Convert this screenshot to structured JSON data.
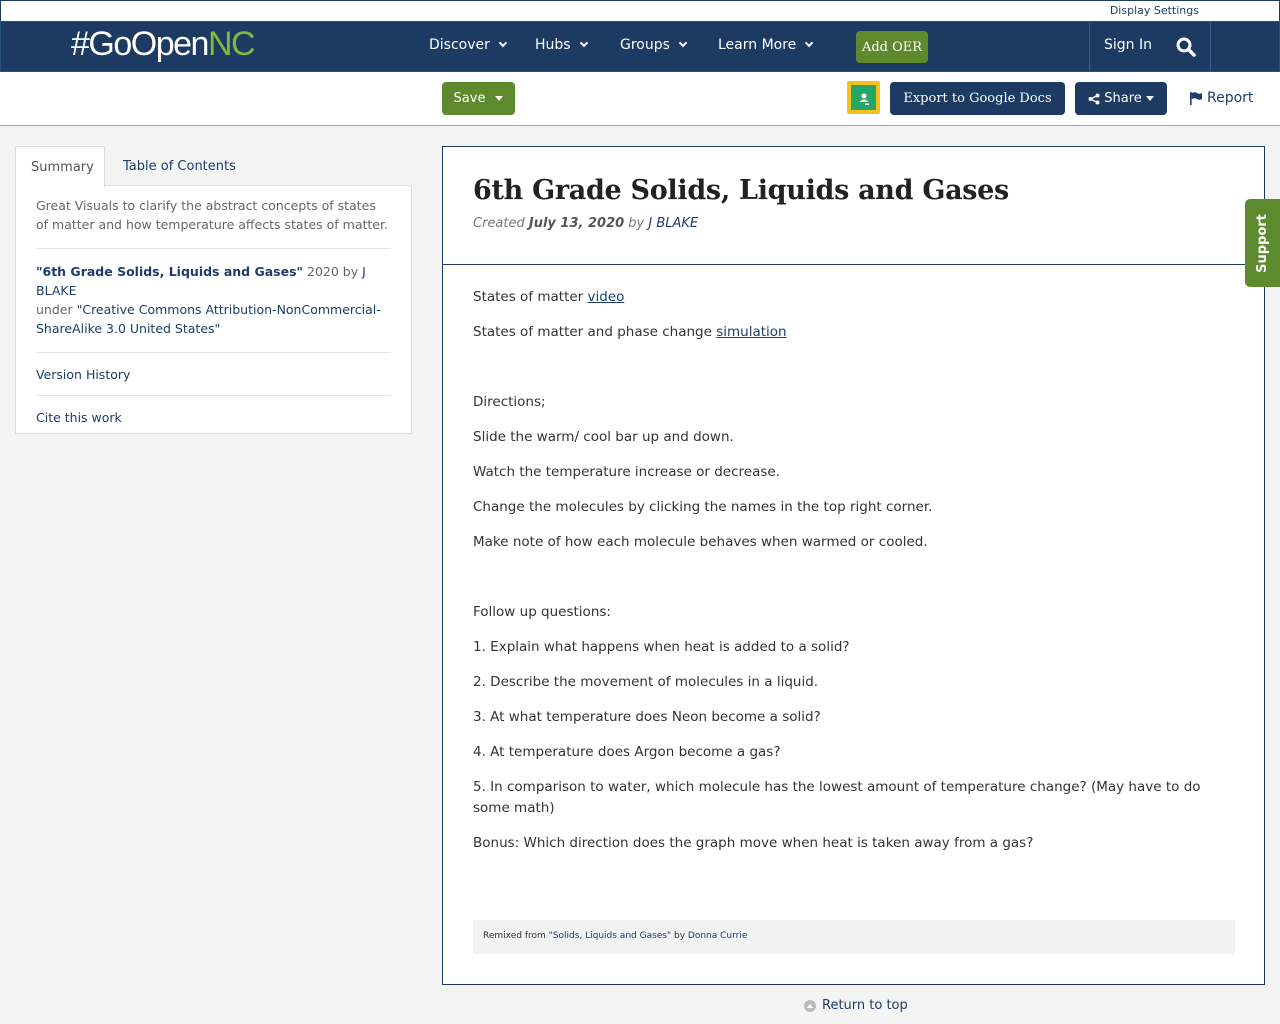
{
  "topbar": {
    "display_settings": "Display Settings"
  },
  "nav": {
    "logo_main": "#GoOpen",
    "logo_accent": "NC",
    "items": [
      {
        "label": "Discover"
      },
      {
        "label": "Hubs"
      },
      {
        "label": "Groups"
      },
      {
        "label": "Learn More"
      }
    ],
    "add_oer": "Add OER",
    "sign_in": "Sign In"
  },
  "actions": {
    "save": "Save",
    "export": "Export to Google Docs",
    "share": "Share",
    "report": "Report"
  },
  "sidebar": {
    "tabs": [
      {
        "label": "Summary"
      },
      {
        "label": "Table of Contents"
      }
    ],
    "summary": "Great Visuals to clarify the abstract concepts of states of matter and how temperature affects states of matter.",
    "attribution": {
      "title": "\"6th Grade Solids, Liquids and Gases\"",
      "year_by": " 2020 by ",
      "author": "J BLAKE",
      "under": "under ",
      "license": "\"Creative Commons Attribution-NonCommercial-ShareAlike 3.0 United States\""
    },
    "version_history": "Version History",
    "cite": "Cite this work"
  },
  "resource": {
    "title": "6th Grade Solids, Liquids and Gases",
    "created_label": "Created ",
    "created_date": "July 13, 2020",
    "by_label": " by ",
    "author": "J BLAKE",
    "line1_text": "States of matter ",
    "line1_link": "video",
    "line2_text": "States of matter and phase change ",
    "line2_link": "simulation",
    "paragraphs_a": [
      "Directions;",
      "Slide the warm/ cool bar up and down.",
      "Watch the temperature increase or decrease.",
      "Change the molecules by clicking the names in the top right corner.",
      "Make note of how each molecule behaves when warmed or cooled."
    ],
    "paragraphs_b": [
      "Follow up questions:",
      "1. Explain what happens when heat is added to a solid?",
      "2. Describe the movement of molecules in a liquid.",
      "3. At what temperature does Neon become a solid?",
      "4. At temperature does Argon become a gas?",
      "5. In comparison to water, which molecule has the lowest amount of temperature change? (May have to do some math)",
      "Bonus: Which direction does the graph move when heat is taken away from a gas?"
    ],
    "remix_prefix": "Remixed from ",
    "remix_source": "\"Solids, Liquids and Gases\"",
    "remix_by": " by ",
    "remix_author": "Donna Currie"
  },
  "support": "Support",
  "return_top": "Return to top"
}
